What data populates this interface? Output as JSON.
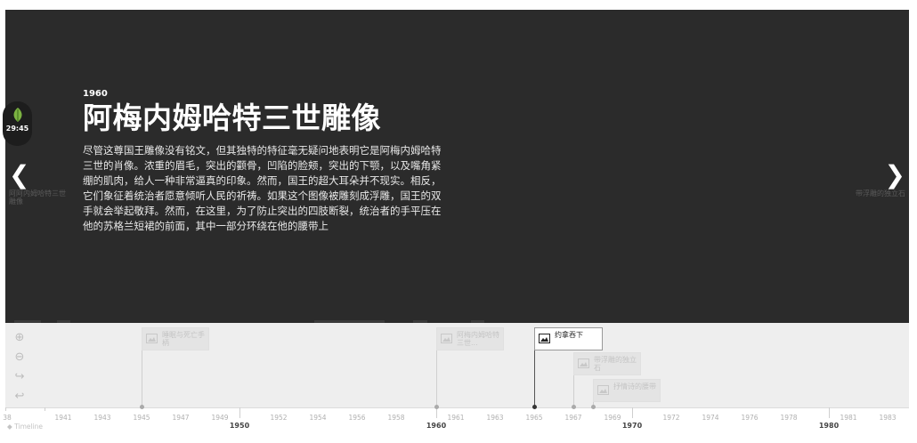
{
  "slide": {
    "date": "1960",
    "title": "阿梅内姆哈特三世雕像",
    "body": "尽管这尊国王雕像没有铭文，但其独特的特征毫无疑问地表明它是阿梅内姆哈特三世的肖像。浓重的眉毛，突出的颧骨，凹陷的脸颊，突出的下颚，以及嘴角紧绷的肌肉，给人一种非常逼真的印象。然而，国王的超大耳朵并不现实。相反，它们象征着统治者愿意倾听人民的祈祷。如果这个图像被雕刻成浮雕，国王的双手就会举起敬拜。然而，在这里，为了防止突出的四肢断裂，统治者的手平压在他的苏格兰短裙的前面，其中一部分环绕在他的腰带上"
  },
  "nav": {
    "prev_arrow": "❮",
    "prev_label": "阿阿内姆哈特三世雕像",
    "next_arrow": "❯",
    "next_label": "带浮雕的独立石"
  },
  "badge": {
    "time": "29:45",
    "icon": "leaf-icon"
  },
  "zoom": {
    "zoom_in": "⊕",
    "zoom_out": "⊖",
    "next": "↪",
    "back": "↩"
  },
  "flags": [
    {
      "label": "睡眠与死亡手柄"
    },
    {
      "label": "阿梅内姆哈特三世..."
    },
    {
      "label": "约拿吞下"
    },
    {
      "label": "带浮雕的独立石"
    },
    {
      "label": "抒情诗的腰带"
    }
  ],
  "axis": {
    "minor": [
      "38",
      "1941",
      "1943",
      "1945",
      "1947",
      "1949",
      "1952",
      "1954",
      "1956",
      "1958",
      "1961",
      "1963",
      "1965",
      "1967",
      "1969",
      "1972",
      "1974",
      "1976",
      "1978",
      "1981",
      "1983"
    ],
    "major": [
      "1950",
      "1960",
      "1970",
      "1980"
    ]
  },
  "footer": {
    "brand": "◆ Timeline"
  }
}
